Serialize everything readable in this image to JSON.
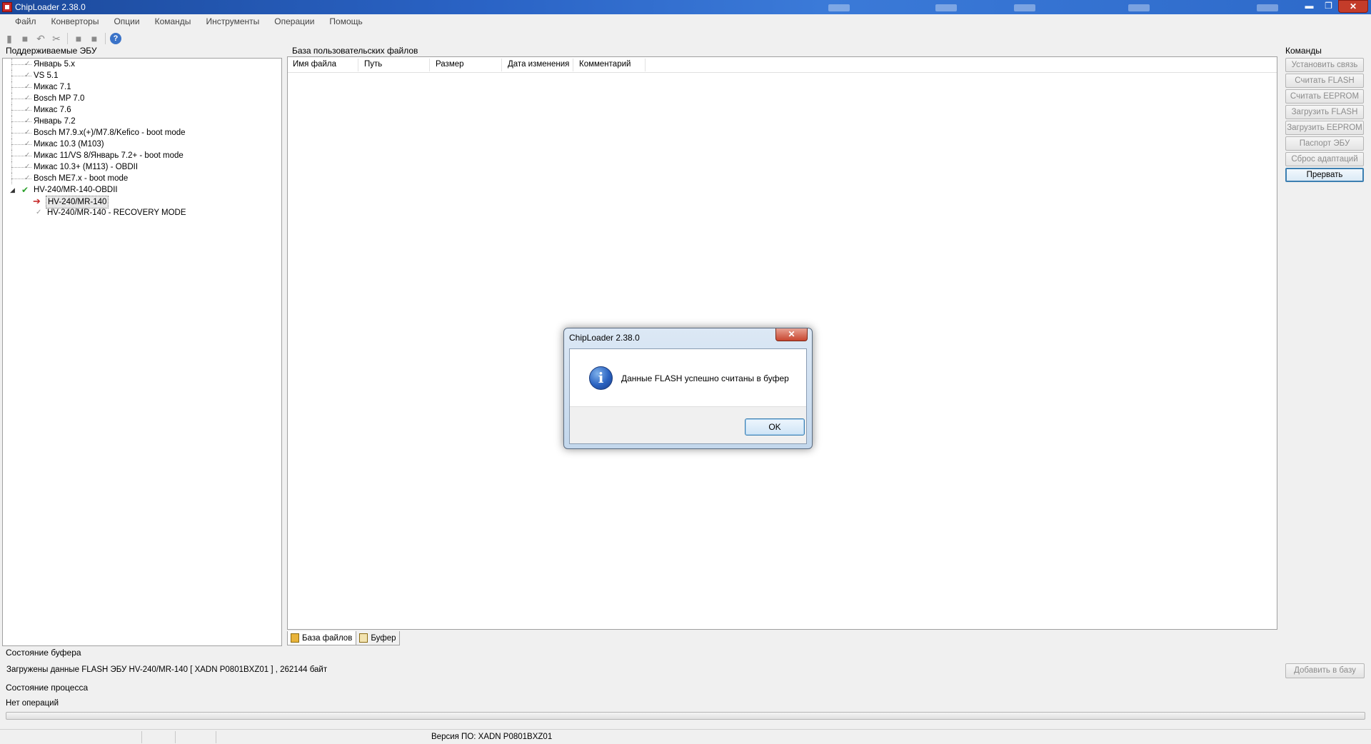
{
  "window": {
    "title": "ChipLoader 2.38.0",
    "minimize": "▬",
    "maximize": "❐",
    "close": "✕"
  },
  "menu": [
    "Файл",
    "Конверторы",
    "Опции",
    "Команды",
    "Инструменты",
    "Операции",
    "Помощь"
  ],
  "toolbar": {
    "help_label": "?"
  },
  "ecu_panel": {
    "label": "Поддерживаемые ЭБУ",
    "items": [
      "Январь 5.x",
      "VS 5.1",
      "Микас 7.1",
      "Bosch MP 7.0",
      "Микас 7.6",
      "Январь 7.2",
      "Bosch M7.9.x(+)/M7.8/Kefico - boot mode",
      "Микас 10.3 (M103)",
      "Микас 11/VS 8/Январь 7.2+ - boot mode",
      "Микас 10.3+ (M113) - OBDII",
      "Bosch ME7.x - boot mode",
      "HV-240/MR-140-OBDII"
    ],
    "children": [
      "HV-240/MR-140",
      "HV-240/MR-140 - RECOVERY MODE"
    ]
  },
  "files_panel": {
    "label": "База пользовательских файлов",
    "columns": [
      "Имя файла",
      "Путь",
      "Размер",
      "Дата изменения",
      "Комментарий"
    ],
    "tabs": [
      "База файлов",
      "Буфер"
    ]
  },
  "commands": {
    "label": "Команды",
    "buttons": [
      "Установить связь",
      "Считать FLASH",
      "Считать EEPROM",
      "Загрузить FLASH",
      "Загрузить EEPROM",
      "Паспорт ЭБУ",
      "Сброс адаптаций",
      "Прервать"
    ]
  },
  "buffer": {
    "label": "Состояние буфера",
    "text": "Загружены данные FLASH ЭБУ HV-240/MR-140 [ XADN P0801BXZ01  ] , 262144 байт",
    "add_button": "Добавить в базу"
  },
  "process": {
    "label": "Состояние процесса",
    "text": "Нет операций",
    "progress": 0
  },
  "statusbar": {
    "version": "Версия ПО: XADN P0801BXZ01"
  },
  "dialog": {
    "title": "ChipLoader 2.38.0",
    "close": "✕",
    "icon": "i",
    "message": "Данные FLASH успешно считаны в буфер",
    "ok": "OK"
  }
}
